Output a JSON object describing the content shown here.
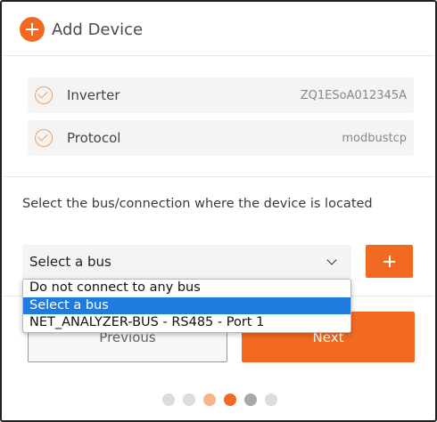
{
  "header": {
    "title": "Add Device"
  },
  "summary": [
    {
      "label": "Inverter",
      "value": "ZQ1ESoA012345A"
    },
    {
      "label": "Protocol",
      "value": "modbustcp"
    }
  ],
  "instruction": "Select the bus/connection where the device is located",
  "bus_select": {
    "value": "Select a bus",
    "options": [
      "Do not connect to any bus",
      "Select a bus",
      "NET_ANALYZER-BUS - RS485 - Port 1"
    ],
    "selected_index": 1
  },
  "buttons": {
    "previous": "Previous",
    "next": "Next"
  },
  "pager": {
    "total": 6,
    "current": 4
  },
  "colors": {
    "accent": "#f26a21",
    "selection": "#1e7be0"
  }
}
